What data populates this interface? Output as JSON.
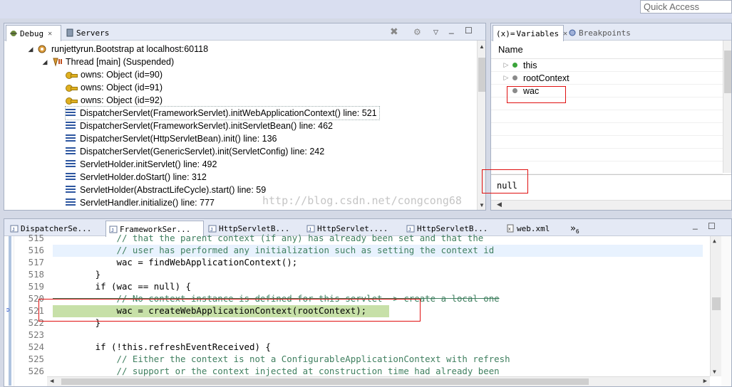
{
  "top": {
    "quick_access": "Quick Access"
  },
  "debug_view": {
    "tabs": [
      {
        "label": "Debug",
        "close": "✕"
      },
      {
        "label": "Servers"
      }
    ],
    "tree": {
      "process": "runjettyrun.Bootstrap at localhost:60118",
      "thread": "Thread [main] (Suspended)",
      "monitors": [
        "owns: Object  (id=90)",
        "owns: Object  (id=91)",
        "owns: Object  (id=92)"
      ],
      "frames": [
        "DispatcherServlet(FrameworkServlet).initWebApplicationContext() line: 521",
        "DispatcherServlet(FrameworkServlet).initServletBean() line: 462",
        "DispatcherServlet(HttpServletBean).init() line: 136",
        "DispatcherServlet(GenericServlet).init(ServletConfig) line: 242",
        "ServletHolder.initServlet() line: 492",
        "ServletHolder.doStart() line: 312",
        "ServletHolder(AbstractLifeCycle).start() line: 59",
        "ServletHandler.initialize() line: 777"
      ]
    }
  },
  "variables_view": {
    "tabs": [
      {
        "label": "Variables",
        "prefix": "(x)=",
        "close": "✕"
      },
      {
        "label": "Breakpoints"
      }
    ],
    "column_header": "Name",
    "rows": [
      {
        "name": "this",
        "color": "#3aa43a",
        "expand": "▷"
      },
      {
        "name": "rootContext",
        "color": "#8a8a8a",
        "expand": "▷"
      },
      {
        "name": "wac",
        "color": "#8a8a8a",
        "expand": ""
      }
    ],
    "detail_value": "null"
  },
  "editor": {
    "tabs": [
      "DispatcherSe...",
      "FrameworkSer...",
      "HttpServletB...",
      "HttpServlet....",
      "HttpServletB...",
      "web.xml"
    ],
    "tab_overflow": "»",
    "tab_overflow_count": "6",
    "lines": [
      {
        "n": "515",
        "t": "            // that the parent context (if any) has already been set and that the"
      },
      {
        "n": "516",
        "t": "            // user has performed any initialization such as setting the context id"
      },
      {
        "n": "517",
        "t": "            wac = findWebApplicationContext();"
      },
      {
        "n": "518",
        "t": "        }"
      },
      {
        "n": "519",
        "t": "        if (wac == null) {"
      },
      {
        "n": "520",
        "t": "            // No context instance is defined for this servlet -> create a local one"
      },
      {
        "n": "521",
        "t": "            wac = createWebApplicationContext(rootContext);"
      },
      {
        "n": "522",
        "t": "        }"
      },
      {
        "n": "523",
        "t": ""
      },
      {
        "n": "524",
        "t": "        if (!this.refreshEventReceived) {"
      },
      {
        "n": "525",
        "t": "            // Either the context is not a ConfigurableApplicationContext with refresh"
      },
      {
        "n": "526",
        "t": "            // support or the context injected at construction time had already been"
      }
    ]
  },
  "watermark": "http://blog.csdn.net/congcong68",
  "colors": {
    "highlight_box": "#e01010",
    "debug_line": "#c7e0a8",
    "comment": "#3f7f5f",
    "keyword": "#7f0055"
  }
}
